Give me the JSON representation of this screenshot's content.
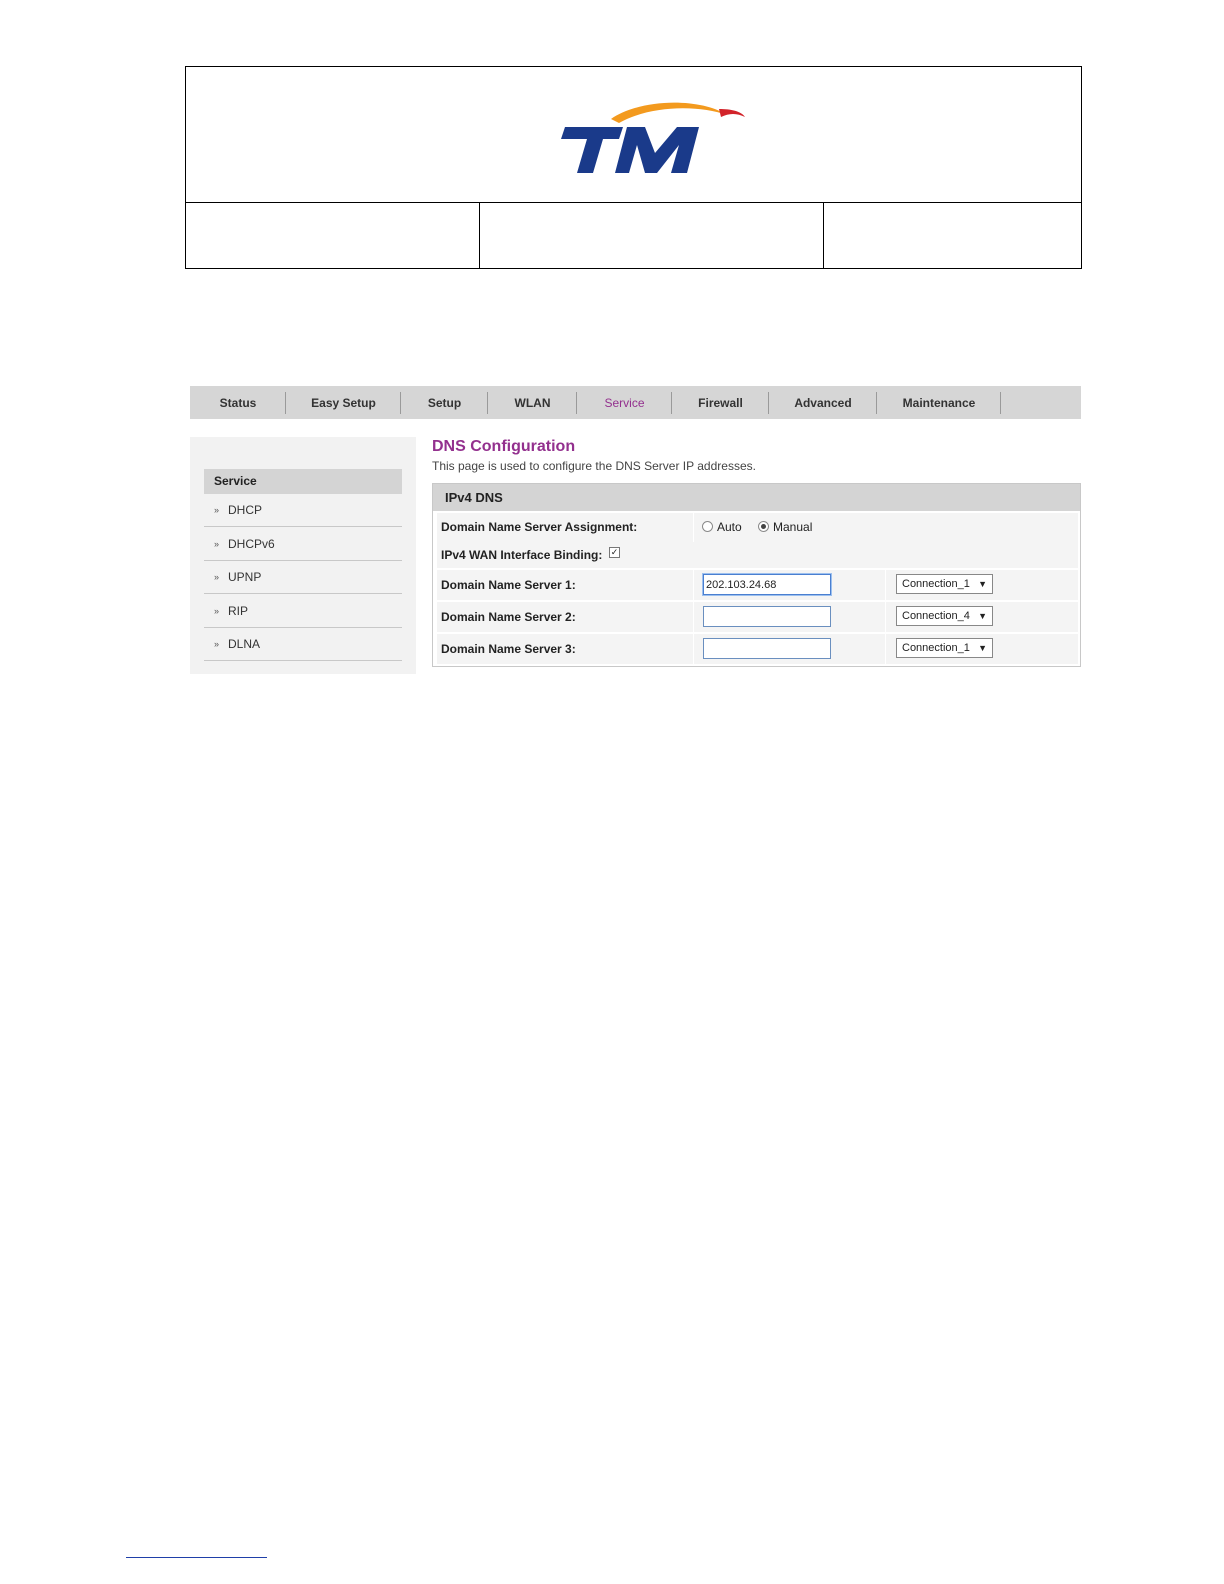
{
  "nav": {
    "items": [
      {
        "label": "Status"
      },
      {
        "label": "Easy Setup"
      },
      {
        "label": "Setup"
      },
      {
        "label": "WLAN"
      },
      {
        "label": "Service"
      },
      {
        "label": "Firewall"
      },
      {
        "label": "Advanced"
      },
      {
        "label": "Maintenance"
      }
    ],
    "active": "Service",
    "active_color": "#93308e"
  },
  "sidebar": {
    "title": "Service",
    "items": [
      {
        "label": "DHCP"
      },
      {
        "label": "DHCPv6"
      },
      {
        "label": "UPNP"
      },
      {
        "label": "RIP"
      },
      {
        "label": "DLNA"
      }
    ]
  },
  "main": {
    "title": "DNS Configuration",
    "description": "This page is used to configure the DNS Server IP addresses.",
    "panel_title": "IPv4 DNS",
    "assignment": {
      "label": "Domain Name Server Assignment:",
      "options": [
        "Auto",
        "Manual"
      ],
      "selected": "Manual"
    },
    "binding": {
      "label": "IPv4 WAN Interface Binding:",
      "checked": true
    },
    "servers": [
      {
        "label": "Domain Name Server 1:",
        "value": "202.103.24.68",
        "connection": "Connection_1"
      },
      {
        "label": "Domain Name Server 2:",
        "value": "",
        "connection": "Connection_4"
      },
      {
        "label": "Domain Name Server 3:",
        "value": "",
        "connection": "Connection_1"
      }
    ]
  },
  "brand": {
    "logo": "TM",
    "blue": "#1a3a8a",
    "orange": "#f39a1e",
    "red": "#d2232a"
  }
}
